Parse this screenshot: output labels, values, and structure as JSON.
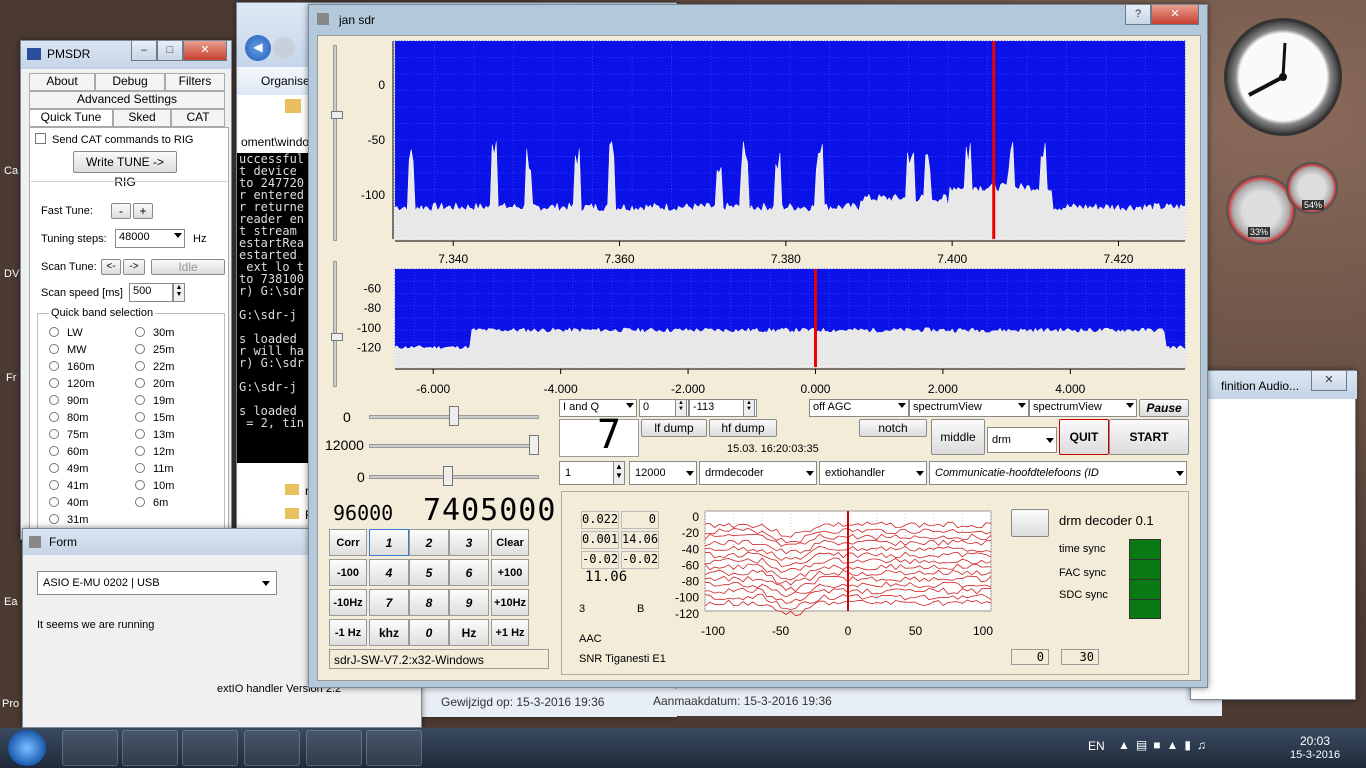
{
  "desktop": {
    "left_labels": [
      "Ca",
      "DV",
      "Fr",
      "Ea",
      "Pro"
    ]
  },
  "pmsdr": {
    "title": "PMSDR",
    "tabs": [
      "About",
      "Debug",
      "Filters",
      "Advanced Settings",
      "Quick Tune",
      "Sked",
      "CAT"
    ],
    "send_cat": "Send CAT commands to RIG",
    "write_tune": "Write TUNE -> RIG",
    "fast_tune": "Fast Tune:",
    "fast_minus": "-",
    "fast_plus": "+",
    "tuning_steps_label": "Tuning steps:",
    "tuning_steps": "48000",
    "hz": "Hz",
    "scan_tune": "Scan Tune:",
    "scan_left": "<-",
    "scan_right": "->",
    "idle": "Idle",
    "scan_speed_label": "Scan speed [ms]",
    "scan_speed": "500",
    "band_group": "Quick band selection",
    "bands_left": [
      "LW",
      "MW",
      "160m",
      "120m",
      "90m",
      "80m",
      "75m",
      "60m",
      "49m",
      "41m",
      "40m",
      "31m"
    ],
    "bands_right": [
      "30m",
      "25m",
      "22m",
      "20m",
      "19m",
      "15m",
      "13m",
      "12m",
      "11m",
      "10m",
      "6m"
    ]
  },
  "explorer": {
    "organise": "Organiser",
    "path": "oment\\window",
    "terminal_lines": [
      "uccessful",
      "t device",
      "to 247720",
      "r entered",
      "r returne",
      "reader en",
      "t stream",
      "estartRea",
      "estarted",
      " ext lo t",
      "to 738100",
      "r) G:\\sdr",
      "",
      "G:\\sdr-j",
      "",
      "s loaded",
      "r will ha",
      "r) G:\\sdr",
      "",
      "G:\\sdr-j",
      "",
      "s loaded",
      " = 2, tin"
    ],
    "files": [
      "re",
      "Ri",
      "R"
    ],
    "modified": "Gewijzigd op: 15-3-2016 19:36",
    "created": "Aanmaakdatum: 15-3-2016 19:36"
  },
  "form": {
    "title": "Form",
    "device": "ASIO E-MU 0202 | USB",
    "status": "It seems we are running",
    "version": "extIO handler Version 2.2"
  },
  "audio_win": {
    "title": "finition Audio..."
  },
  "sdr": {
    "title": "jan sdr",
    "help": "?",
    "top_ticks": [
      "7.340",
      "7.360",
      "7.380",
      "7.400",
      "7.420"
    ],
    "top_y": [
      "0",
      "-50",
      "-100"
    ],
    "bot_ticks": [
      "-6.000",
      "-4.000",
      "-2.000",
      "0.000",
      "2.000",
      "4.000"
    ],
    "bot_y": [
      "-60",
      "-80",
      "-100",
      "-120"
    ],
    "slider1": "0",
    "slider2": "12000",
    "slider3": "0",
    "iq": "I and Q",
    "val0": "0",
    "val_113": "-113",
    "agc": "off AGC",
    "spec1": "spectrumView",
    "spec2": "spectrumView",
    "pause": "Pause",
    "big_digit": "7",
    "lf_dump": "lf dump",
    "hf_dump": "hf dump",
    "notch": "notch",
    "middle": "middle",
    "mode": "drm",
    "quit": "QUIT",
    "start": "START",
    "datetime": "15.03. 16:20:03:35",
    "spin1": "1",
    "rate": "12000",
    "decoder": "drmdecoder",
    "handler": "extiohandler",
    "audio_dev": "Communicatie-hoofdtelefoons (ID",
    "samplerate": "96000",
    "frequency": "7405000",
    "keypad": [
      [
        "Corr",
        "1",
        "2",
        "3",
        "Clear"
      ],
      [
        "-100 Hz",
        "4",
        "5",
        "6",
        "+100 Hz"
      ],
      [
        "-10Hz",
        "7",
        "8",
        "9",
        "+10Hz"
      ],
      [
        "-1 Hz",
        "khz",
        "0",
        "Hz",
        "+1 Hz"
      ]
    ],
    "version": "sdrJ-SW-V7.2:x32-Windows",
    "drm": {
      "grid": [
        [
          "0.022",
          "0"
        ],
        [
          "0.001",
          "14.06"
        ],
        [
          "-0.02",
          "-0.02"
        ]
      ],
      "v11": "11.06",
      "v3": "3",
      "vB": "B",
      "aac": "AAC",
      "snr": "SNR Tiganesti E1",
      "y_ticks": [
        "0",
        "-20",
        "-40",
        "-60",
        "-80",
        "-100",
        "-120"
      ],
      "x_ticks": [
        "-100",
        "-50",
        "0",
        "50",
        "100"
      ],
      "title": "drm decoder 0.1",
      "time_sync": "time sync",
      "fac_sync": "FAC sync",
      "sdc_sync": "SDC sync",
      "out1": "0",
      "out2": "30"
    }
  },
  "taskbar": {
    "lang": "EN",
    "time": "20:03",
    "date": "15-3-2016"
  },
  "gadgets": {
    "cpu": "33%",
    "mem": "54%"
  },
  "chart_data": [
    {
      "type": "area",
      "title": "",
      "xlabel": "",
      "ylabel": "",
      "x_ticks": [
        "7.340",
        "7.360",
        "7.380",
        "7.400",
        "7.420"
      ],
      "y_ticks": [
        "0",
        "-50",
        "-100"
      ],
      "ylim": [
        -140,
        40
      ],
      "marker_x": 7.405,
      "noise_floor": -115,
      "peaks_x": [
        7.335,
        7.345,
        7.349,
        7.355,
        7.359,
        7.372,
        7.375,
        7.379,
        7.384,
        7.395,
        7.397,
        7.402,
        7.407,
        7.411
      ]
    },
    {
      "type": "area",
      "title": "",
      "xlabel": "",
      "ylabel": "",
      "x_ticks": [
        "-6.000",
        "-4.000",
        "-2.000",
        "0.000",
        "2.000",
        "4.000"
      ],
      "y_ticks": [
        "-60",
        "-80",
        "-100",
        "-120"
      ],
      "ylim": [
        -140,
        -40
      ],
      "marker_x": 0,
      "noise_floor": -105
    }
  ]
}
